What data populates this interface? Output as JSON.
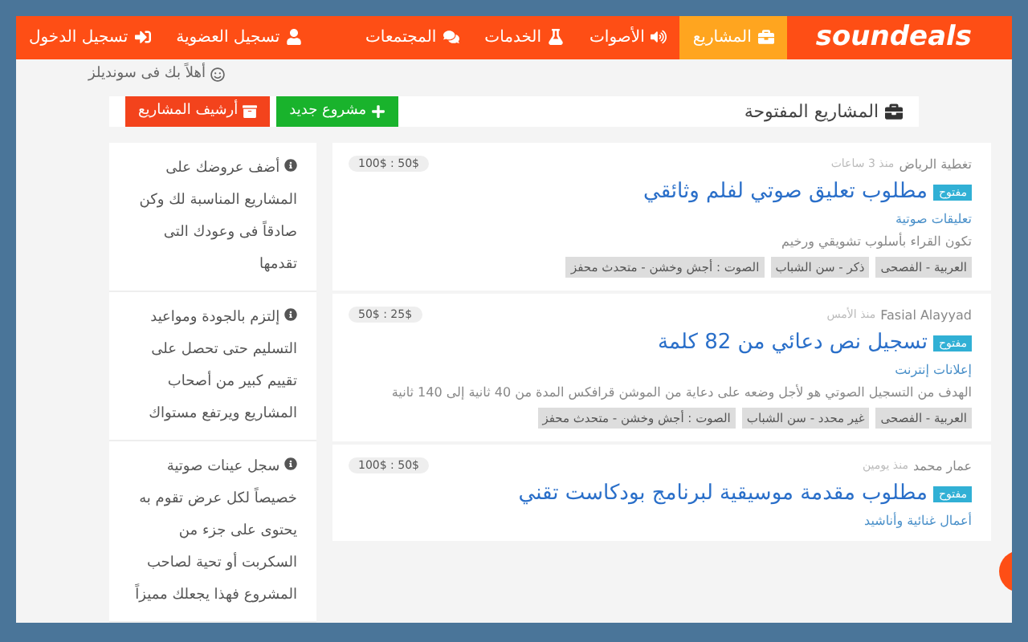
{
  "logo": "soundeals",
  "nav": [
    {
      "label": "المشاريع",
      "kind": "projects",
      "selected": true
    },
    {
      "label": "الأصوات",
      "kind": "voices",
      "selected": false
    },
    {
      "label": "الخدمات",
      "kind": "services",
      "selected": false
    },
    {
      "label": "المجتمعات",
      "kind": "communities",
      "selected": false
    }
  ],
  "nav_user": [
    {
      "label": "تسجيل العضوية",
      "kind": "register"
    },
    {
      "label": "تسجيل الدخول",
      "kind": "login"
    }
  ],
  "welcome": "أهلاً بك فى سونديلز",
  "header": {
    "title": "المشاريع المفتوحة",
    "buttons": [
      {
        "label": "مشروع جديد",
        "kind": "new"
      },
      {
        "label": "أرشيف المشاريع",
        "kind": "archive"
      }
    ]
  },
  "projects": [
    {
      "author": "تغطية الرياض",
      "time": "منذ 3 ساعات",
      "price": "100$ : 50$",
      "status": "مفتوح",
      "title": "مطلوب تعليق صوتي لفلم وثائقي",
      "category": "تعليقات صوتية",
      "description": "تكون القراء بأسلوب تشويقي ورخيم",
      "tags": [
        "العربية - الفصحى",
        "ذكر - سن الشباب",
        "الصوت : أجش وخشن - متحدث محفز"
      ]
    },
    {
      "author": "Fasial Alayyad",
      "time": "منذ الأمس",
      "price": "50$ : 25$",
      "status": "مفتوح",
      "title": "تسجيل نص دعائي من 82 كلمة",
      "category": "إعلانات إنترنت",
      "description": "الهدف من التسجيل الصوتي هو لأجل وضعه على دعاية من الموشن قرافكس المدة من 40 ثانية إلى 140 ثانية",
      "tags": [
        "العربية - الفصحى",
        "غير محدد - سن الشباب",
        "الصوت : أجش وخشن - متحدث محفز"
      ]
    },
    {
      "author": "عمار محمد",
      "time": "منذ يومين",
      "price": "100$ : 50$",
      "status": "مفتوح",
      "title": "مطلوب مقدمة موسيقية لبرنامج بودكاست تقني",
      "category": "أعمال غنائية وأناشيد"
    }
  ],
  "tips": [
    "أضف عروضك على المشاريع المناسبة لك وكن صادقاً فى وعودك التى تقدمها",
    "إلتزم بالجودة ومواعيد التسليم حتى تحصل على تقييم كبير من أصحاب المشاريع ويرتفع مستواك",
    "سجل عينات صوتية خصيصاً لكل عرض تقوم به يحتوى على جزء من السكربت أو تحية لصاحب المشروع فهذا يجعلك مميزاً"
  ]
}
